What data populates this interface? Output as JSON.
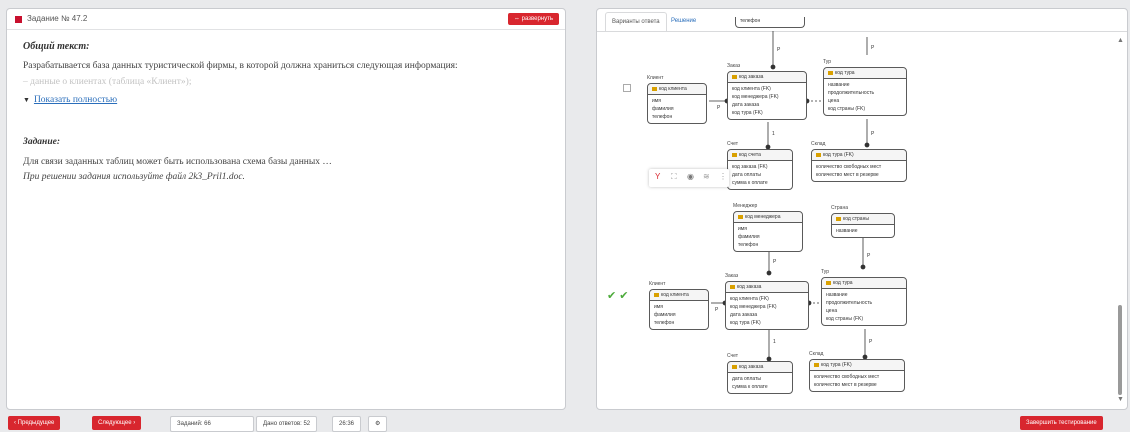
{
  "task": {
    "title": "Задание № 47.2",
    "expand_label": "⇔ развернуть",
    "general_heading": "Общий текст:",
    "intro": "Разрабатывается база данных туристической фирмы, в которой должна храниться следующая информация:",
    "faded_line": "– данные о клиентах (таблица «Клиент»);",
    "show_full": "Показать полностью",
    "assignment_heading": "Задание:",
    "assignment_text": "Для связи заданных таблиц может быть использована схема базы данных …",
    "file_note": "При решении задания используйте файл 2k3_Pril1.doc."
  },
  "answers": {
    "tabs": [
      "Варианты ответа",
      "Решение"
    ],
    "diagram1": {
      "entities": {
        "client": {
          "title": "Клиент",
          "pk": "код клиента",
          "fields": [
            "имя",
            "фамилия",
            "телефон"
          ]
        },
        "order": {
          "title": "Заказ",
          "pk": "код заказа",
          "fields": [
            "код клиента (FK)",
            "код менеджера (FK)",
            "дата заказа",
            "код тура (FK)"
          ]
        },
        "tour": {
          "title": "Тур",
          "pk": "код тура",
          "fields": [
            "название",
            "продолжительность",
            "цена",
            "код страны (FK)"
          ]
        },
        "bill": {
          "title": "Счет",
          "pk": "код счета",
          "fields": [
            "код заказа (FK)",
            "дата оплаты",
            "сумма к оплате"
          ]
        },
        "warehouse": {
          "title": "Склад",
          "pk": "код тура (FK)",
          "fields": [
            "количество свободных мест",
            "количество мест в резерве"
          ]
        },
        "top_label": "телефон"
      }
    },
    "diagram2": {
      "entities": {
        "manager": {
          "title": "Менеджер",
          "pk": "код менеджера",
          "fields": [
            "имя",
            "фамилия",
            "телефон"
          ]
        },
        "country": {
          "title": "Страна",
          "pk": "код страны",
          "fields": [
            "название"
          ]
        },
        "client": {
          "title": "Клиент",
          "pk": "код клиента",
          "fields": [
            "имя",
            "фамилия",
            "телефон"
          ]
        },
        "order": {
          "title": "Заказ",
          "pk": "код заказа",
          "fields": [
            "код клиента (FK)",
            "код менеджера (FK)",
            "дата заказа",
            "код тура (FK)"
          ]
        },
        "tour": {
          "title": "Тур",
          "pk": "код тура",
          "fields": [
            "название",
            "продолжительность",
            "цена",
            "код страны (FK)"
          ]
        },
        "bill": {
          "title": "Счет",
          "pk": "код заказа",
          "fields": [
            "дата оплаты",
            "сумма к оплате"
          ]
        },
        "warehouse": {
          "title": "Склад",
          "pk": "код тура (FK)",
          "fields": [
            "количество свободных мест",
            "количество мест в резерве"
          ]
        }
      }
    },
    "rel_p": "P",
    "rel_one": "1",
    "checks": "✔✔",
    "toolbar_icons": [
      "filter-icon",
      "fit-icon",
      "eye-icon",
      "layers-icon"
    ]
  },
  "footer": {
    "prev": "‹ Предыдущее",
    "next": "Следующее ›",
    "tasks": "Заданий: 66",
    "answered": "Дано ответов: 52",
    "time": "26:36",
    "finish": "Завершить тестирование"
  },
  "colors": {
    "accent": "#d8262e",
    "link": "#2a6ebb",
    "check": "#4caa3a"
  }
}
